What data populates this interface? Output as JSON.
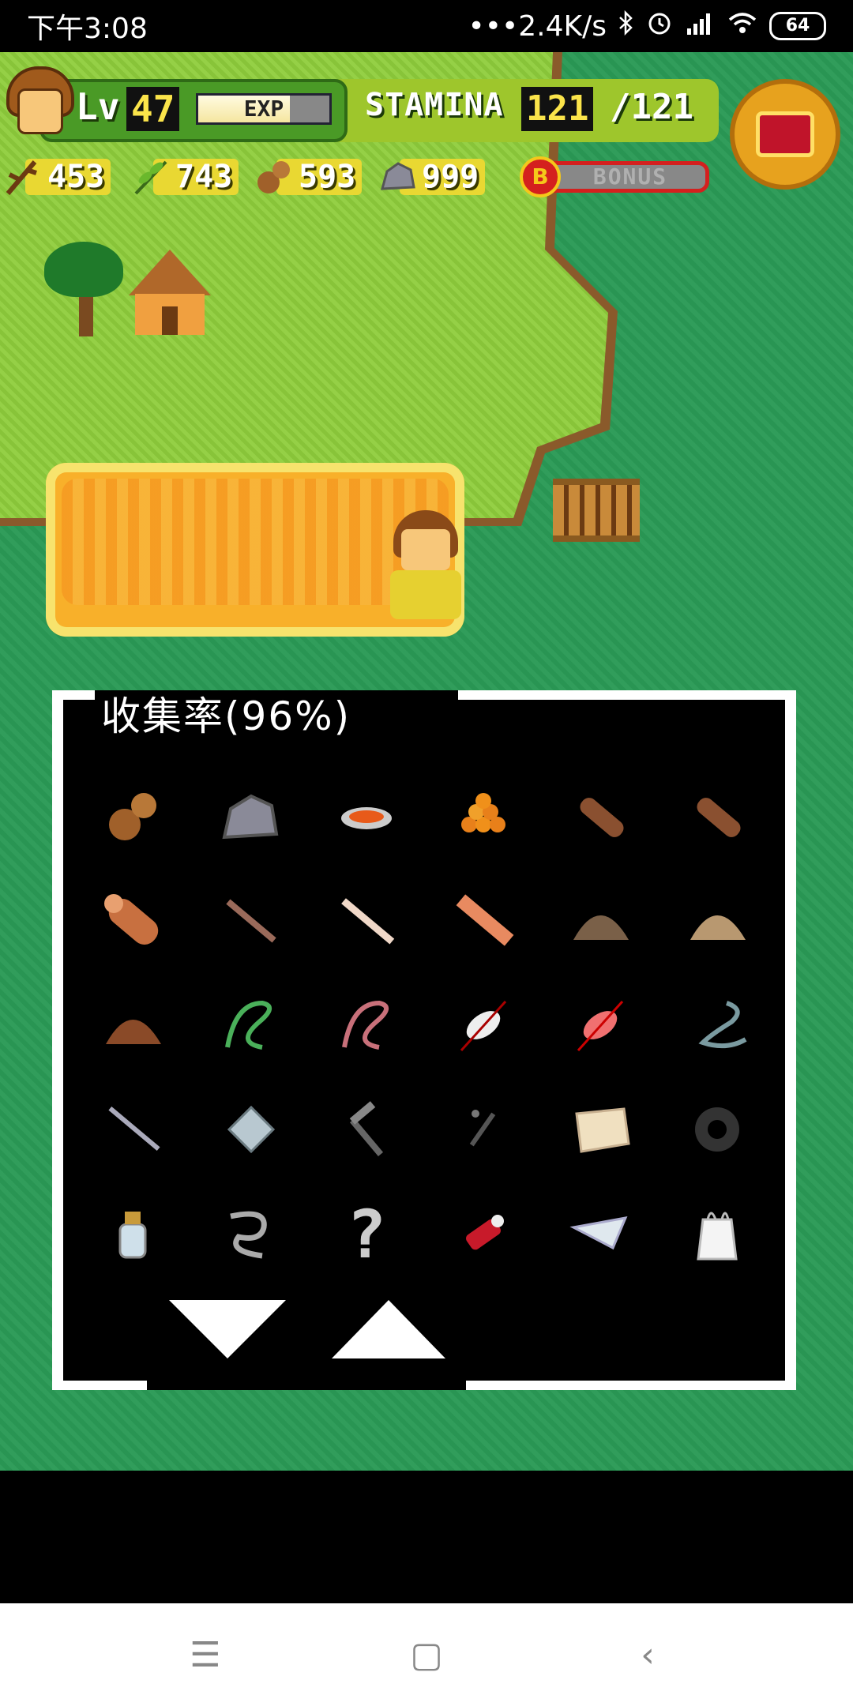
{
  "status_bar": {
    "time": "下午3:08",
    "network_speed": "•••2.4K/s",
    "icons": [
      "bluetooth-icon",
      "alarm-icon",
      "hd-signal-icon",
      "wifi-icon"
    ],
    "battery": "64"
  },
  "hud": {
    "level_label": "Lv",
    "level": "47",
    "exp_label": "EXP",
    "exp_fraction": 0.7,
    "stamina_label": "STAMINA",
    "stamina_current": "121",
    "stamina_max": "/121",
    "resources": [
      {
        "icon": "branch-icon",
        "value": "453"
      },
      {
        "icon": "leaf-icon",
        "value": "743"
      },
      {
        "icon": "coconut-icon",
        "value": "593"
      },
      {
        "icon": "stone-icon",
        "value": "999"
      }
    ],
    "bonus_badge": "B",
    "bonus_label": "BONUS"
  },
  "panel": {
    "title": "收集率(96%)",
    "items": [
      "coconuts-icon",
      "stone-icon",
      "soup-bowl-icon",
      "orange-berries-icon",
      "log-icon",
      "log-icon",
      "big-log-icon",
      "thin-stick-icon",
      "birch-stick-icon",
      "plank-icon",
      "dirt-pile-icon",
      "sand-pile-icon",
      "clay-pile-icon",
      "green-rope-icon",
      "pink-rope-icon",
      "white-yarn-icon",
      "red-yarn-icon",
      "wire-coil-icon",
      "iron-rod-icon",
      "glass-shard-icon",
      "hammer-icon",
      "nail-icon",
      "cloth-scrap-icon",
      "tire-icon",
      "small-bottle-icon",
      "chain-icon",
      "question-mark-icon",
      "red-cylinder-icon",
      "plastic-sheet-icon",
      "plastic-bag-icon"
    ],
    "question_mark": "?"
  },
  "colors": {
    "ocean": "#2a9a56",
    "grass": "#8fce3c",
    "sand": "#f8b02a",
    "hud_green": "#4a9a26",
    "hud_yellow": "#e9d832",
    "bonus_red": "#d4201e"
  },
  "nav": {
    "menu_glyph": "☰",
    "home_glyph": "▢",
    "back_glyph": "‹"
  }
}
